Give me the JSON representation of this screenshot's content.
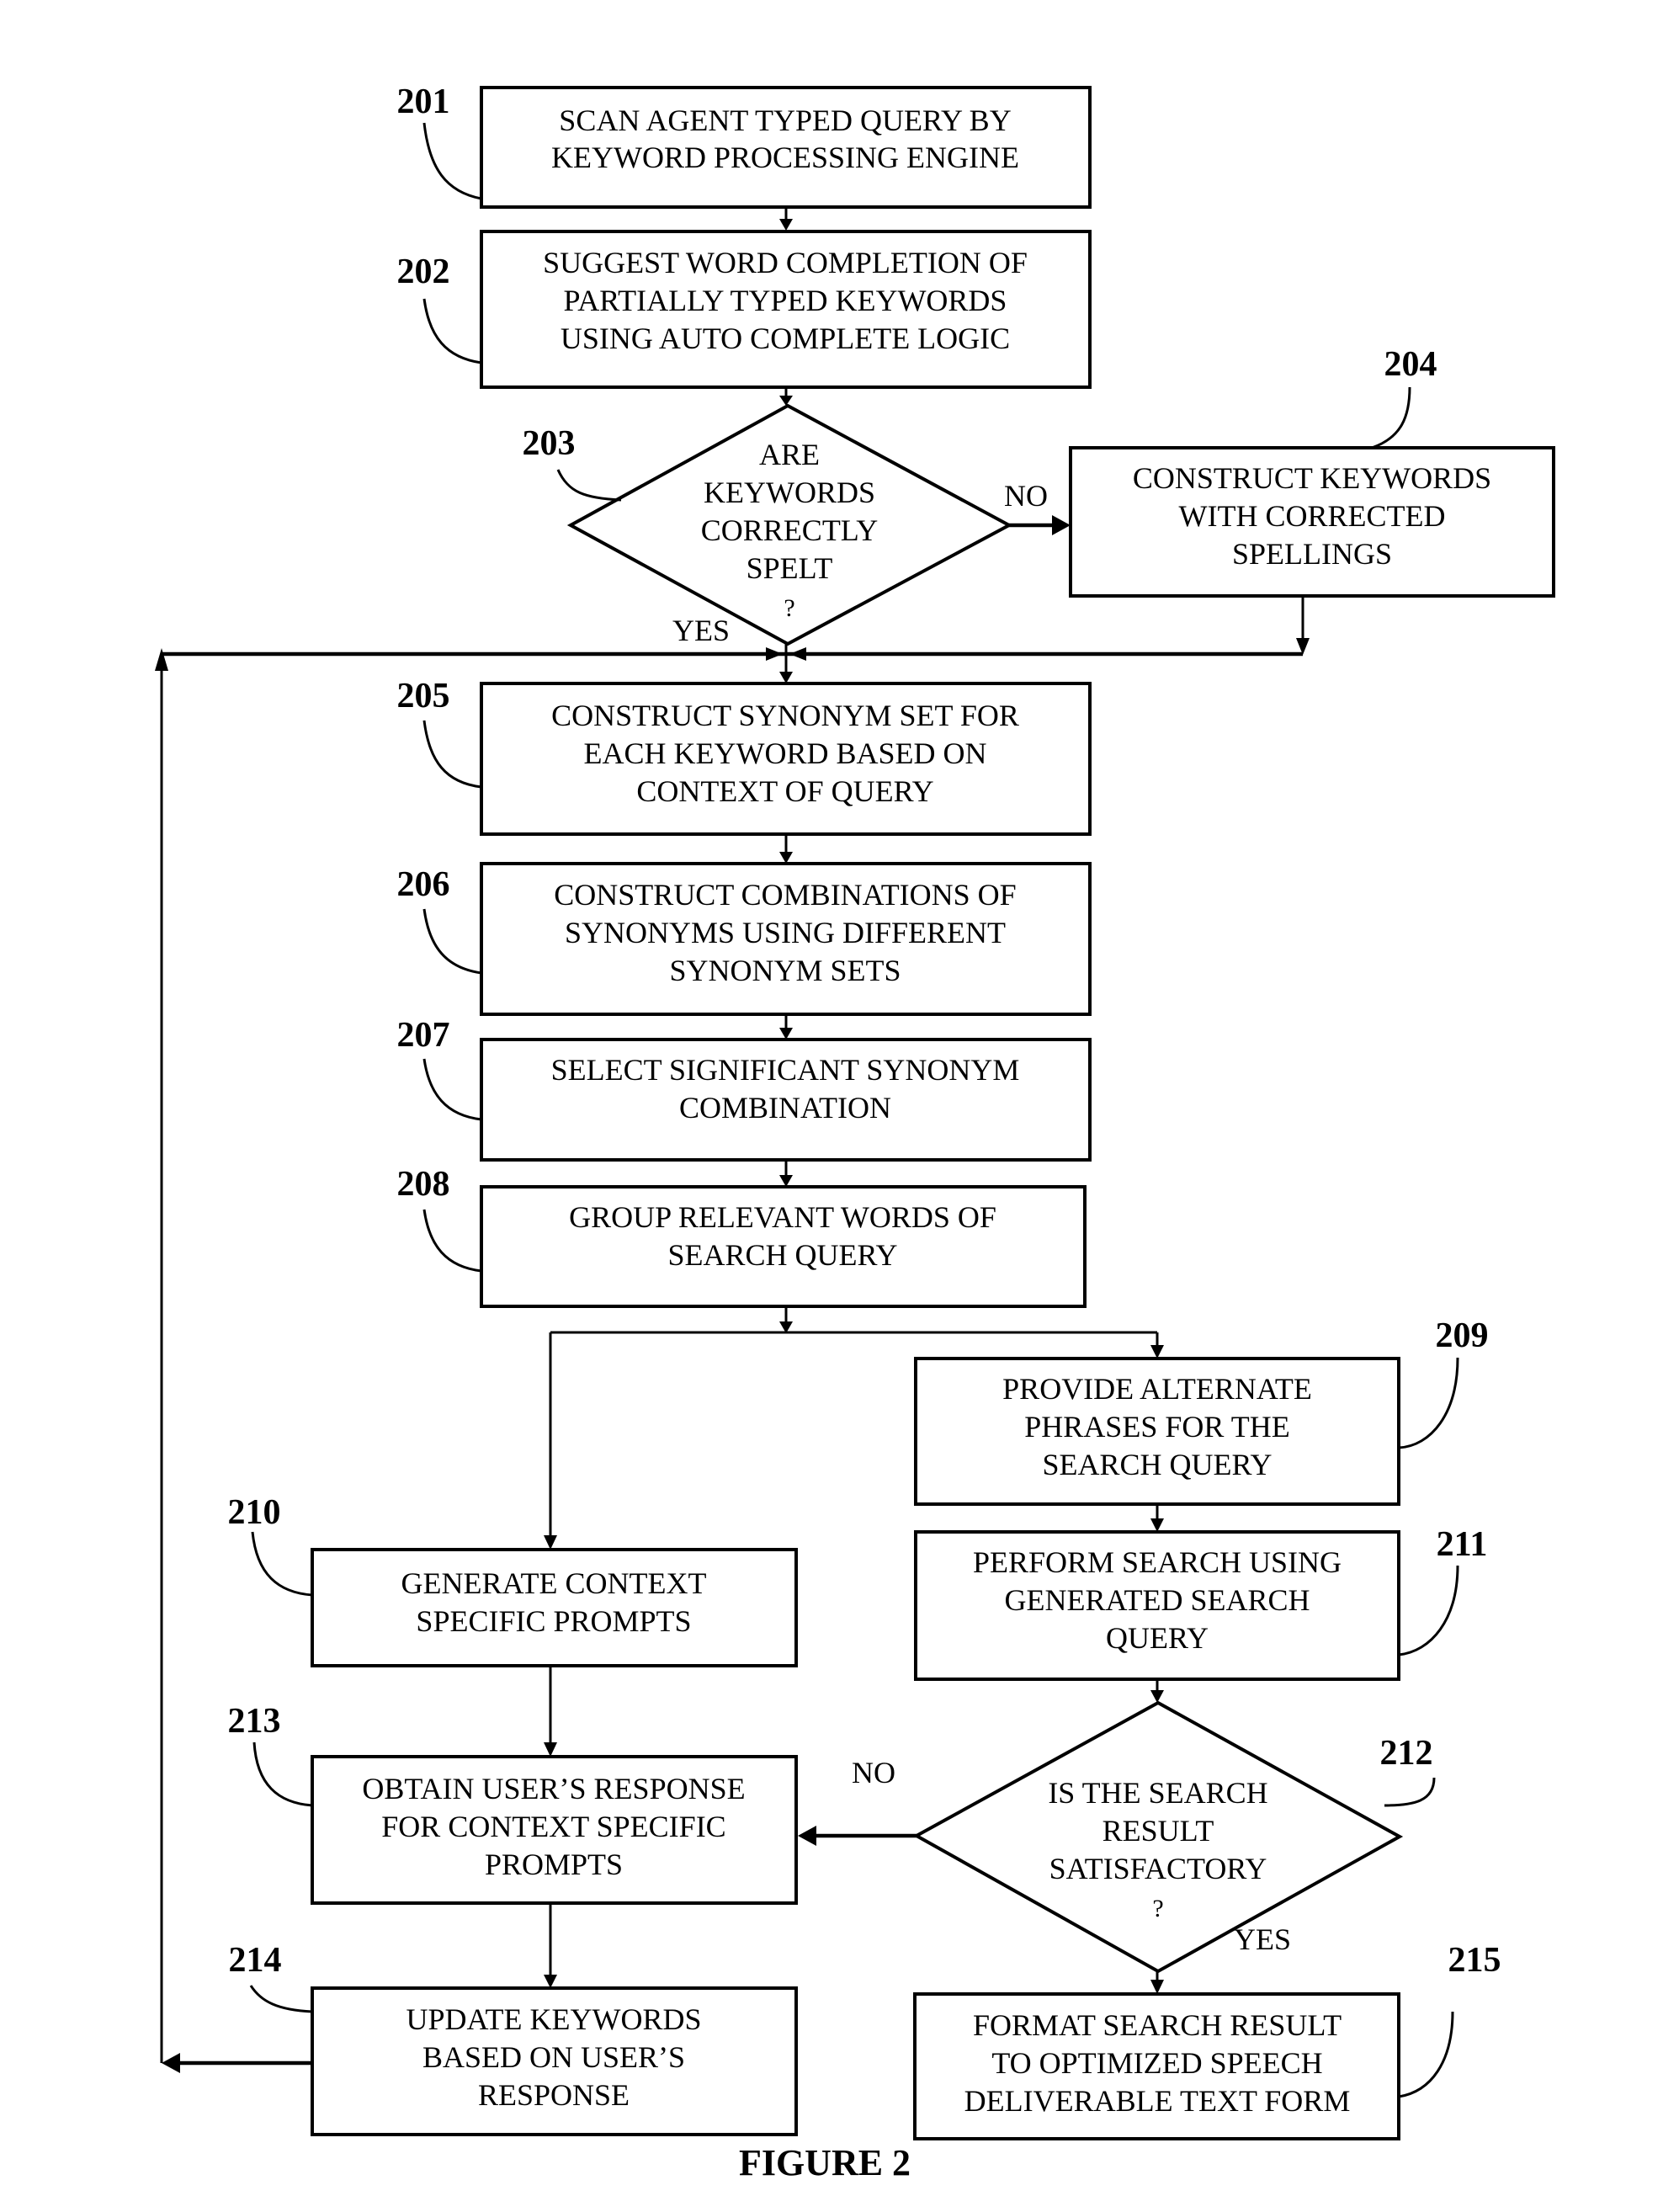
{
  "figure": {
    "caption": "FIGURE 2",
    "steps": {
      "s201": {
        "ref": "201",
        "lines": [
          "SCAN AGENT TYPED QUERY BY",
          "KEYWORD PROCESSING ENGINE"
        ]
      },
      "s202": {
        "ref": "202",
        "lines": [
          "SUGGEST WORD COMPLETION OF",
          "PARTIALLY TYPED KEYWORDS",
          "USING AUTO COMPLETE LOGIC"
        ]
      },
      "s203": {
        "ref": "203",
        "lines": [
          "ARE",
          "KEYWORDS",
          "CORRECTLY",
          "SPELT",
          "?"
        ]
      },
      "s204": {
        "ref": "204",
        "lines": [
          "CONSTRUCT KEYWORDS",
          "WITH CORRECTED",
          "SPELLINGS"
        ]
      },
      "s205": {
        "ref": "205",
        "lines": [
          "CONSTRUCT SYNONYM SET FOR",
          "EACH KEYWORD BASED ON",
          "CONTEXT OF QUERY"
        ]
      },
      "s206": {
        "ref": "206",
        "lines": [
          "CONSTRUCT COMBINATIONS OF",
          "SYNONYMS USING DIFFERENT",
          "SYNONYM SETS"
        ]
      },
      "s207": {
        "ref": "207",
        "lines": [
          "SELECT SIGNIFICANT SYNONYM",
          "COMBINATION"
        ]
      },
      "s208": {
        "ref": "208",
        "lines": [
          "GROUP RELEVANT WORDS OF",
          "SEARCH QUERY"
        ]
      },
      "s209": {
        "ref": "209",
        "lines": [
          "PROVIDE ALTERNATE",
          "PHRASES FOR THE",
          "SEARCH QUERY"
        ]
      },
      "s210": {
        "ref": "210",
        "lines": [
          "GENERATE CONTEXT",
          "SPECIFIC PROMPTS"
        ]
      },
      "s211": {
        "ref": "211",
        "lines": [
          "PERFORM SEARCH USING",
          "GENERATED SEARCH",
          "QUERY"
        ]
      },
      "s212": {
        "ref": "212",
        "lines": [
          "IS THE SEARCH",
          "RESULT",
          "SATISFACTORY",
          "?"
        ]
      },
      "s213": {
        "ref": "213",
        "lines": [
          "OBTAIN USER’S RESPONSE",
          "FOR CONTEXT SPECIFIC",
          "PROMPTS"
        ]
      },
      "s214": {
        "ref": "214",
        "lines": [
          "UPDATE KEYWORDS",
          "BASED ON USER’S",
          "RESPONSE"
        ]
      },
      "s215": {
        "ref": "215",
        "lines": [
          "FORMAT SEARCH RESULT",
          "TO OPTIMIZED SPEECH",
          "DELIVERABLE TEXT FORM"
        ]
      }
    },
    "branches": {
      "d203_no": "NO",
      "d203_yes": "YES",
      "d212_no": "NO",
      "d212_yes": "YES"
    }
  }
}
